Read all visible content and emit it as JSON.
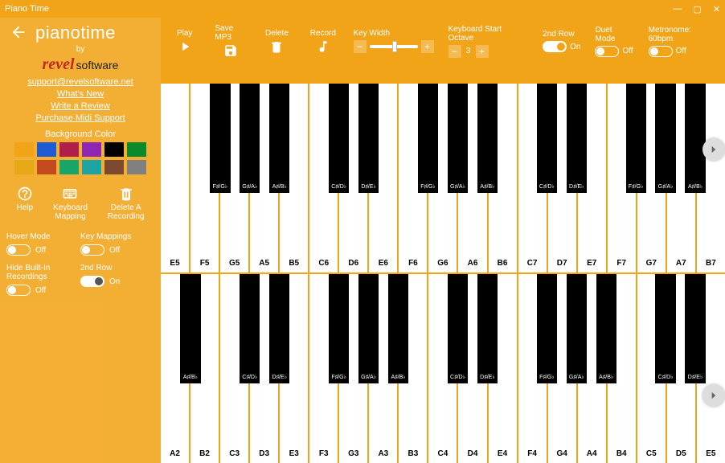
{
  "titlebar": {
    "title": "Piano Time"
  },
  "sidebar": {
    "app_name": "pianotime",
    "by": "by",
    "brand_revel": "revel",
    "brand_software": "software",
    "links": {
      "support_email": "support@revelsoftware.net",
      "whats_new": "What's New",
      "write_review": "Write a Review",
      "purchase_midi": "Purchase Midi Support"
    },
    "background_color_label": "Background Color",
    "swatch_colors": [
      "#f2a418",
      "#1e5bd6",
      "#b01f4c",
      "#8e26b3",
      "#000000",
      "#0a8a2a",
      "#e6a817",
      "#c24a1e",
      "#16a66a",
      "#1fa3a3",
      "#7c4a30",
      "#808080"
    ],
    "tools": {
      "help": "Help",
      "keyboard_mapping": "Keyboard\nMapping",
      "delete_recording": "Delete A\nRecording"
    },
    "toggles": {
      "hover_mode": {
        "label": "Hover Mode",
        "state": "Off"
      },
      "key_mappings": {
        "label": "Key Mappings",
        "state": "Off"
      },
      "hide_builtin": {
        "label": "Hide Built-In Recordings",
        "state": "Off"
      },
      "second_row": {
        "label": "2nd Row",
        "state": "On"
      }
    }
  },
  "toolbar": {
    "play": "Play",
    "save_mp3": "Save MP3",
    "delete": "Delete",
    "record": "Record",
    "key_width": {
      "label": "Key Width"
    },
    "start_octave": {
      "label": "Keyboard Start Octave",
      "value": "3"
    },
    "row2": {
      "label": "2nd Row",
      "state": "On"
    },
    "duet": {
      "label": "Duet Mode",
      "state": "Off"
    },
    "metronome": {
      "label": "Metronome: 60bpm",
      "state": "Off"
    }
  },
  "keyboards": {
    "top": {
      "white_notes": [
        "E5",
        "F5",
        "G5",
        "A5",
        "B5",
        "C6",
        "D6",
        "E6",
        "F6",
        "G6",
        "A6",
        "B6",
        "C7",
        "D7",
        "E7",
        "F7",
        "G7",
        "A7",
        "B7"
      ]
    },
    "bottom": {
      "white_notes": [
        "A2",
        "B2",
        "C3",
        "D3",
        "E3",
        "F3",
        "G3",
        "A3",
        "B3",
        "C4",
        "D4",
        "E4",
        "F4",
        "G4",
        "A4",
        "B4",
        "C5",
        "D5",
        "E5"
      ]
    },
    "black_labels": {
      "Cs": "C♯/D♭",
      "Ds": "D♯/E♭",
      "Fs": "F♯/G♭",
      "Gs": "G♯/A♭",
      "As": "A♯/B♭"
    }
  }
}
